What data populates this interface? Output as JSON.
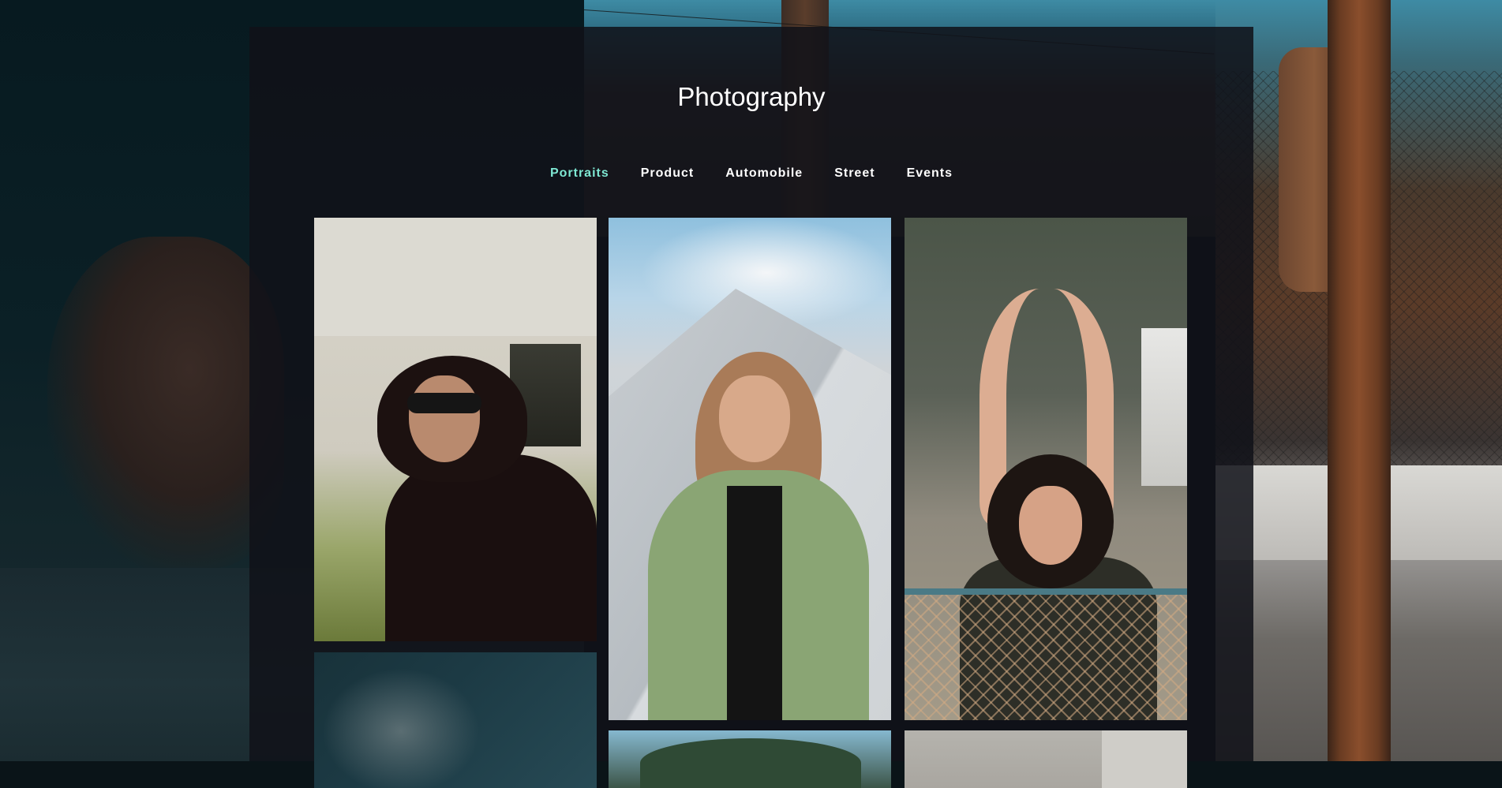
{
  "site": {
    "title": "Photography"
  },
  "nav": {
    "items": [
      {
        "label": "Portraits",
        "active": true
      },
      {
        "label": "Product",
        "active": false
      },
      {
        "label": "Automobile",
        "active": false
      },
      {
        "label": "Street",
        "active": false
      },
      {
        "label": "Events",
        "active": false
      }
    ],
    "active_color": "#7ee8d3"
  },
  "gallery": {
    "category": "Portraits",
    "photos": [
      {
        "subject": "woman-sunglasses-portrait"
      },
      {
        "subject": "woman-green-coat-portrait"
      },
      {
        "subject": "woman-raised-arms-portrait"
      },
      {
        "subject": "partial-photo-shadow"
      },
      {
        "subject": "partial-photo-trees"
      },
      {
        "subject": "partial-photo-wall"
      }
    ]
  },
  "colors": {
    "panel": "#101218",
    "text": "#ffffff",
    "accent": "#7ee8d3"
  }
}
